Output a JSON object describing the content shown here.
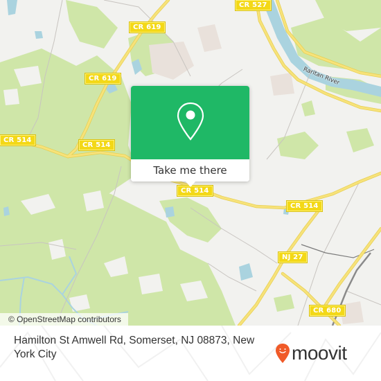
{
  "map": {
    "road_shields": [
      {
        "id": "cr527",
        "label": "CR 527"
      },
      {
        "id": "cr619-top",
        "label": "CR 619"
      },
      {
        "id": "cr619-mid",
        "label": "CR 619"
      },
      {
        "id": "cr514-left",
        "label": "CR 514"
      },
      {
        "id": "cr514-mid",
        "label": "CR 514"
      },
      {
        "id": "cr514-center",
        "label": "CR 514"
      },
      {
        "id": "cr514-right",
        "label": "CR 514"
      },
      {
        "id": "nj27",
        "label": "NJ 27"
      },
      {
        "id": "cr680",
        "label": "CR 680"
      }
    ],
    "water_labels": [
      {
        "id": "raritan",
        "label": "Raritan River"
      }
    ],
    "colors": {
      "background": "#f2f2ef",
      "park": "#cfe6a8",
      "water": "#aad3df",
      "road": "#f7e27a",
      "shield": "#f3d817"
    }
  },
  "popup": {
    "icon": "map-pin-icon",
    "button_label": "Take me there",
    "color": "#1fb866"
  },
  "attribution": "© OpenStreetMap contributors",
  "footer": {
    "address": "Hamilton St Amwell Rd, Somerset, NJ 08873, New York City",
    "logo_text": "moovit",
    "logo_icon": "moovit-pin-icon",
    "logo_color": "#f05a28"
  }
}
